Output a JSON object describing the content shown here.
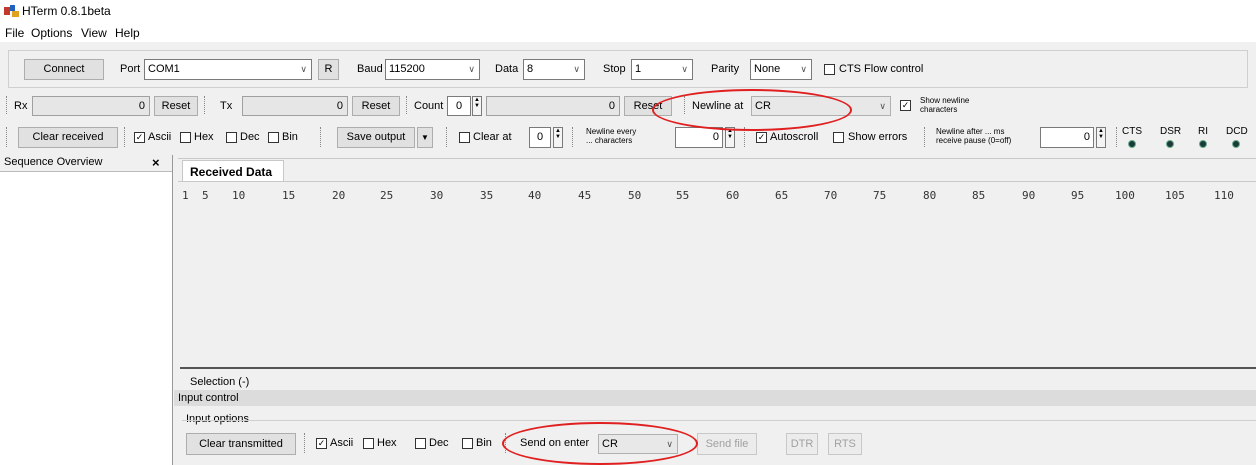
{
  "window": {
    "title": "HTerm 0.8.1beta"
  },
  "menu": [
    "File",
    "Options",
    "View",
    "Help"
  ],
  "connection": {
    "connect_label": "Connect",
    "port_label": "Port",
    "port_value": "COM1",
    "r_label": "R",
    "baud_label": "Baud",
    "baud_value": "115200",
    "data_label": "Data",
    "data_value": "8",
    "stop_label": "Stop",
    "stop_value": "1",
    "parity_label": "Parity",
    "parity_value": "None",
    "cts_label": "CTS Flow control"
  },
  "counters": {
    "rx_label": "Rx",
    "rx_value": "0",
    "rx_reset": "Reset",
    "tx_label": "Tx",
    "tx_value": "0",
    "tx_reset": "Reset",
    "count_label": "Count",
    "count_value": "0",
    "count_display": "0",
    "count_reset": "Reset",
    "newline_at_label": "Newline at",
    "newline_at_value": "CR",
    "show_newline_label_1": "Show newline",
    "show_newline_label_2": "characters"
  },
  "display": {
    "clear_received": "Clear received",
    "ascii": "Ascii",
    "hex": "Hex",
    "dec": "Dec",
    "bin": "Bin",
    "save_output": "Save output",
    "clear_at": "Clear at",
    "clear_at_value": "0",
    "newline_every_1": "Newline every",
    "newline_every_2": "... characters",
    "newline_every_value": "0",
    "autoscroll": "Autoscroll",
    "show_errors": "Show errors",
    "newline_after_1": "Newline after ... ms",
    "newline_after_2": "receive pause (0=off)",
    "newline_after_value": "0",
    "signals": [
      "CTS",
      "DSR",
      "RI",
      "DCD"
    ]
  },
  "sequence": {
    "title": "Sequence Overview",
    "close": "×"
  },
  "received": {
    "tab": "Received Data",
    "ruler": [
      "1",
      "5",
      "10",
      "15",
      "20",
      "25",
      "30",
      "35",
      "40",
      "45",
      "50",
      "55",
      "60",
      "65",
      "70",
      "75",
      "80",
      "85",
      "90",
      "95",
      "100",
      "105",
      "110"
    ],
    "selection": "Selection (-)"
  },
  "input": {
    "control_label": "Input control",
    "options_label": "Input options",
    "clear_transmitted": "Clear transmitted",
    "ascii": "Ascii",
    "hex": "Hex",
    "dec": "Dec",
    "bin": "Bin",
    "send_on_enter_label": "Send on enter",
    "send_on_enter_value": "CR",
    "send_file": "Send file",
    "dtr": "DTR",
    "rts": "RTS"
  }
}
